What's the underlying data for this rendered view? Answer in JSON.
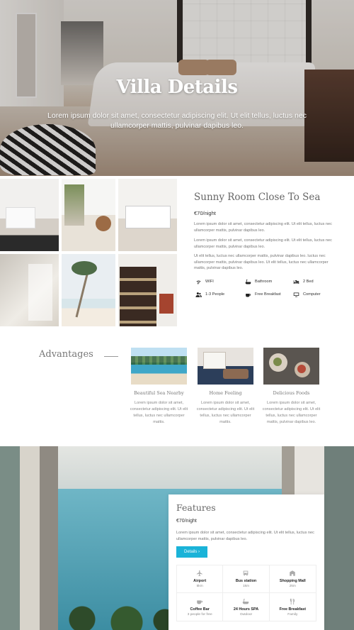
{
  "hero": {
    "title": "Villa Details",
    "subtitle": "Lorem ipsum dolor sit amet, consectetur adipiscing elit. Ut elit tellus, luctus nec ullamcorper mattis, pulvinar dapibus leo."
  },
  "room": {
    "title": "Sunny Room Close To Sea",
    "price": "€70/night",
    "paragraphs": [
      "Lorem ipsum dolor sit amet, consectetur adipiscing elit. Ut elit tellus, luctus nec ullamcorper mattis, pulvinar dapibus leo.",
      "Lorem ipsum dolor sit amet, consectetur adipiscing elit. Ut elit tellus, luctus nec ullamcorper mattis, pulvinar dapibus leo.",
      "Ut elit tellus, luctus nec ullamcorper mattis, pulvinar dapibus leo.  luctus nec ullamcorper mattis, pulvinar dapibus leo. Ut elit tellus, luctus nec ullamcorper mattis, pulvinar dapibus leo."
    ],
    "amenities": [
      {
        "label": "WIFI",
        "icon": "wifi-icon"
      },
      {
        "label": "Bathroom",
        "icon": "bathtub-icon"
      },
      {
        "label": "2 Bed",
        "icon": "bed-icon"
      },
      {
        "label": "1-3 People",
        "icon": "users-icon"
      },
      {
        "label": "Free Breakfast",
        "icon": "coffee-icon"
      },
      {
        "label": "Computer",
        "icon": "monitor-icon"
      }
    ]
  },
  "advantages": {
    "title": "Advantages",
    "cards": [
      {
        "title": "Beautiful Sea Nearby",
        "text": "Lorem ipsum dolor sit amet, consectetur adipiscing elit. Ut elit tellus, luctus nec ullamcorper mattis."
      },
      {
        "title": "Home Feeling",
        "text": "Lorem ipsum dolor sit amet, consectetur adipiscing elit. Ut elit tellus, luctus nec ullamcorper mattis."
      },
      {
        "title": "Delicious Foods",
        "text": "Lorem ipsum dolor sit amet, consectetur adipiscing elit. Ut elit tellus, luctus nec ullamcorper mattis, pulvinar dapibus leo."
      }
    ]
  },
  "features": {
    "title": "Features",
    "price": "€70/night",
    "text": "Lorem ipsum dolor sit amet, consectetur adipiscing elit. Ut elit tellus, luctus nec ullamcorper mattis, pulvinar dapibus leo.",
    "button_label": "Details ›",
    "items": [
      {
        "label": "Airport",
        "sub": "5km",
        "icon": "airplane-icon"
      },
      {
        "label": "Bus station",
        "sub": "1km",
        "icon": "bus-icon"
      },
      {
        "label": "Shopping Mall",
        "sub": "2km",
        "icon": "building-icon"
      },
      {
        "label": "Coffee Bar",
        "sub": "3 people for free",
        "icon": "coffee-cup-icon"
      },
      {
        "label": "24 Hours SPA",
        "sub": "Outdoor",
        "icon": "bathtub-icon"
      },
      {
        "label": "Free Breakfast",
        "sub": "Family",
        "icon": "utensils-icon"
      }
    ],
    "accent_color": "#1ab3d8"
  }
}
